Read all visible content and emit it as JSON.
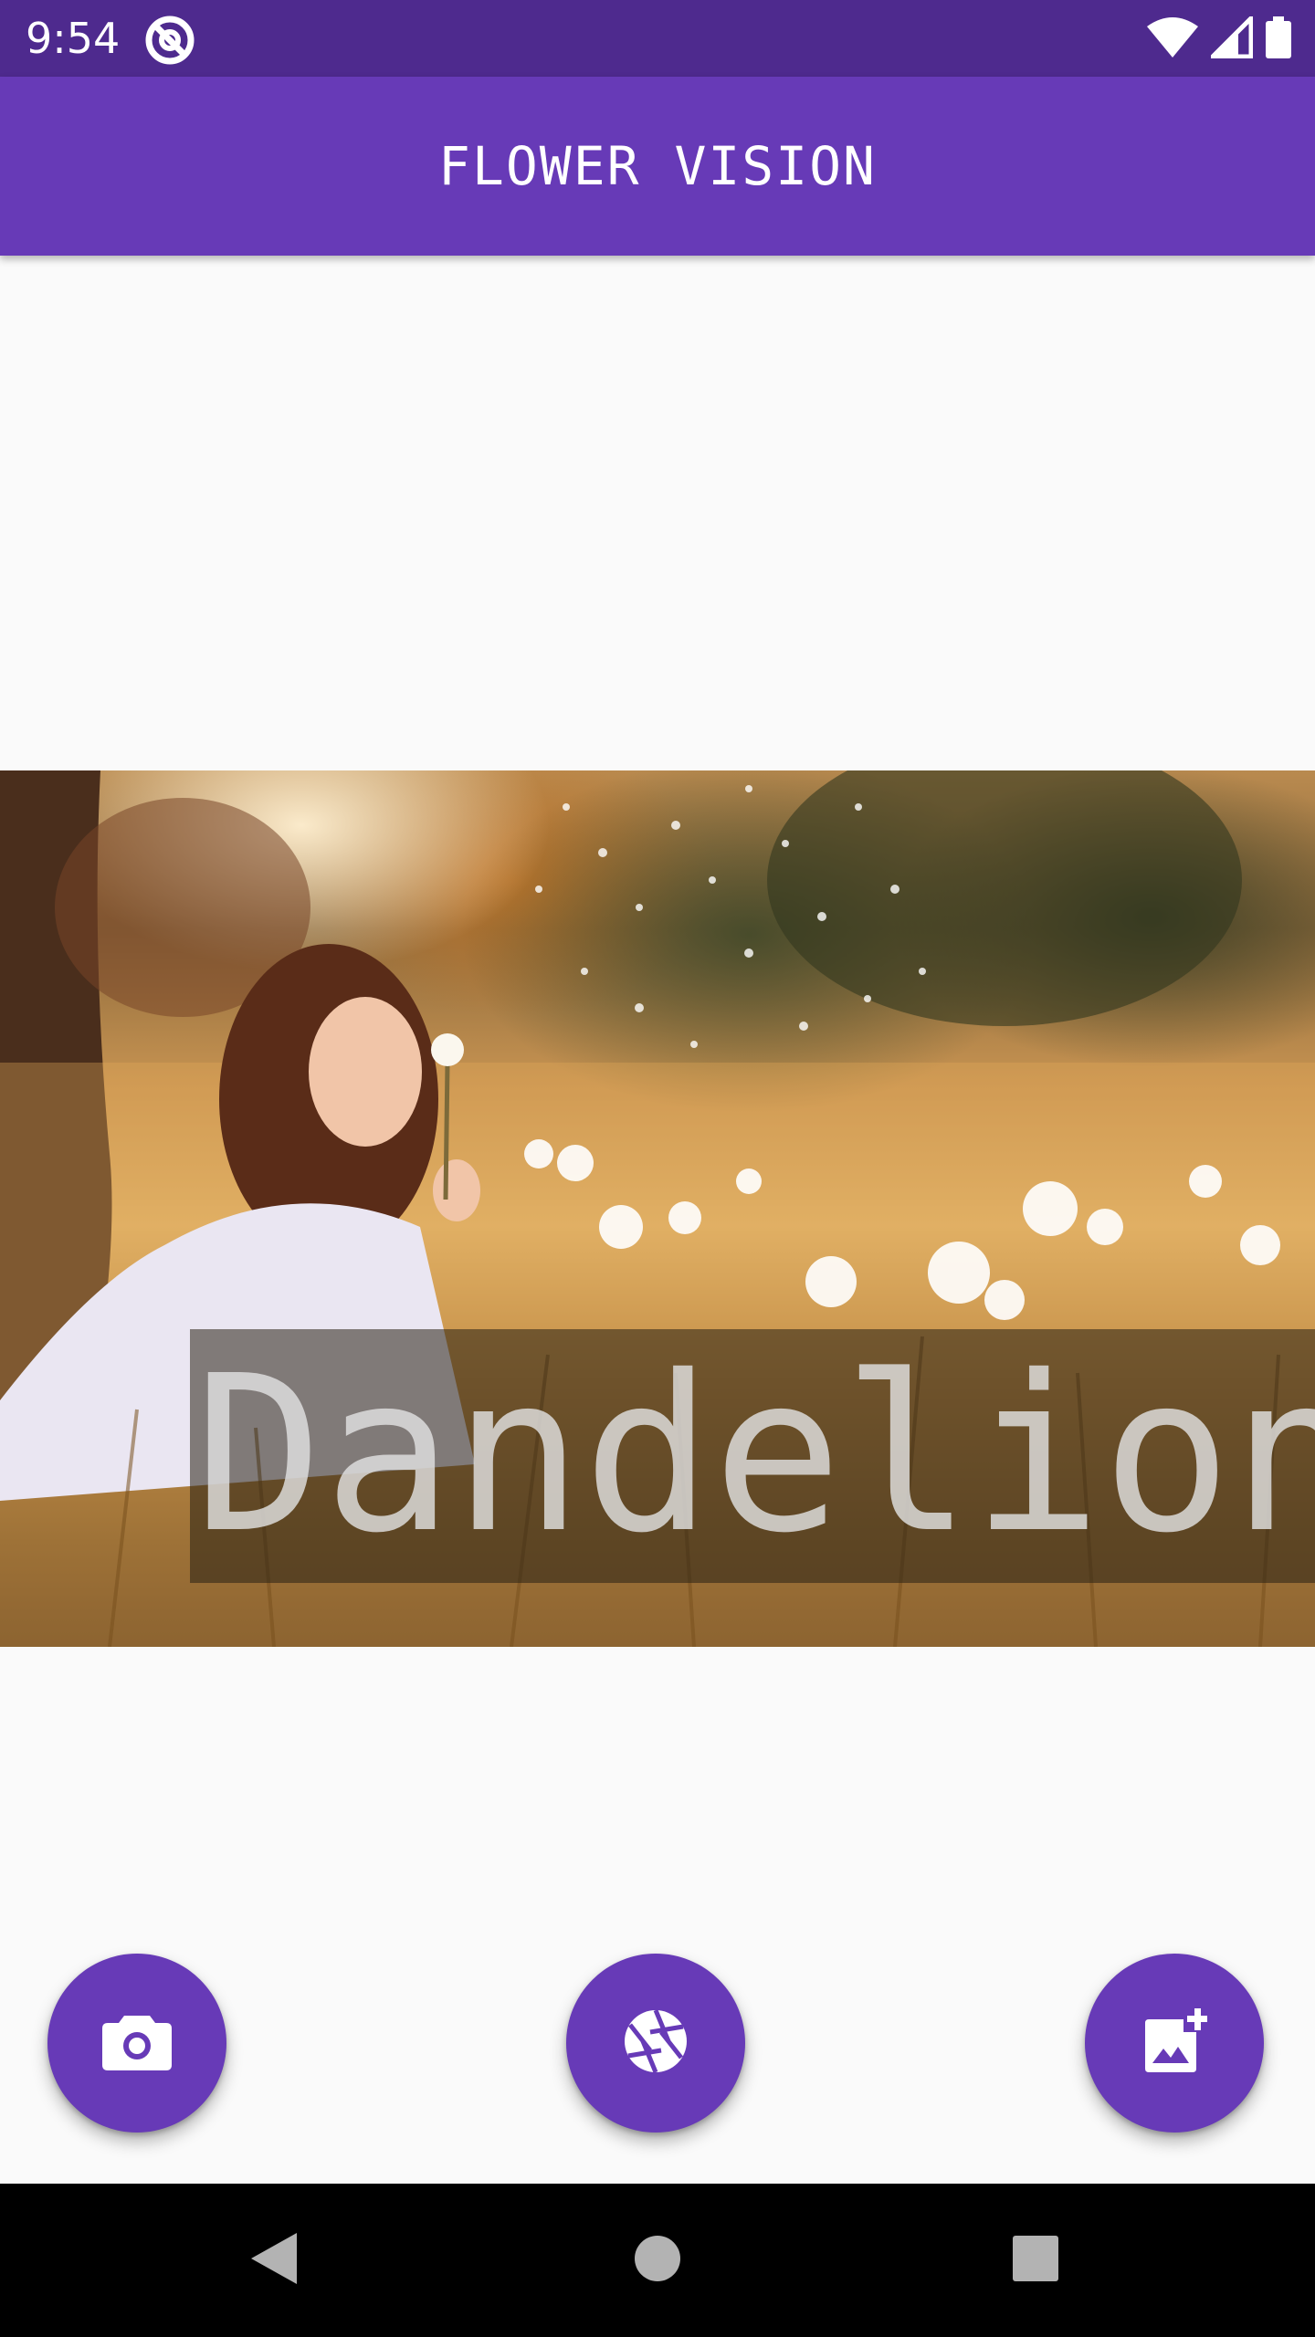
{
  "status_bar": {
    "time": "9:54",
    "icons": [
      "app-notification-icon",
      "wifi-icon",
      "cell-signal-icon",
      "battery-icon"
    ]
  },
  "app_bar": {
    "title": "FLOWER VISION"
  },
  "photo": {
    "description_icon": "photo-image",
    "detected_label": "Dandelion"
  },
  "fabs": [
    {
      "name": "camera-button",
      "icon": "camera-icon"
    },
    {
      "name": "capture-button",
      "icon": "shutter-icon"
    },
    {
      "name": "gallery-button",
      "icon": "add-photo-icon"
    }
  ],
  "nav_bar": {
    "icons": [
      "back-icon",
      "home-icon",
      "recents-icon"
    ]
  },
  "colors": {
    "status_bar": "#4e2a8e",
    "primary": "#673ab7",
    "background": "#fafafa"
  }
}
